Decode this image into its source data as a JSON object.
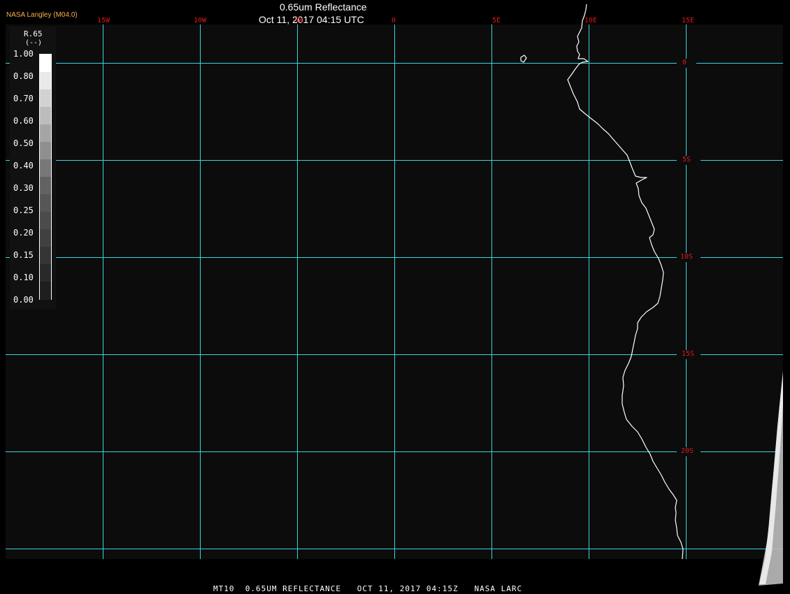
{
  "header": {
    "brand": "NASA Langley (M04.0)",
    "title": "0.65um Reflectance",
    "datetime": "Oct 11, 2017 04:15 UTC"
  },
  "longitude_labels": [
    "15W",
    "10W",
    "5W",
    "0",
    "5E",
    "10E",
    "15E"
  ],
  "latitude_labels": [
    "0",
    "5S",
    "10S",
    "15S",
    "20S"
  ],
  "legend": {
    "name": "R.65",
    "unit": "(--)",
    "ticks": [
      "1.00",
      "0.80",
      "0.70",
      "0.60",
      "0.50",
      "0.40",
      "0.30",
      "0.25",
      "0.20",
      "0.15",
      "0.10",
      "0.00"
    ],
    "levels": [
      1.0,
      0.9,
      0.8,
      0.7,
      0.6,
      0.5,
      0.4,
      0.3,
      0.25,
      0.2,
      0.15,
      0.1,
      0.05,
      0.0
    ]
  },
  "footer": "MT10  0.65UM REFLECTANCE   OCT 11, 2017 04:15Z   NASA LARC",
  "colors": {
    "background": "#0c0c0c",
    "grid": "#38d6e0",
    "grid_label": "#e01818",
    "coastline": "#ffffff",
    "brand": "#f6b04a"
  }
}
